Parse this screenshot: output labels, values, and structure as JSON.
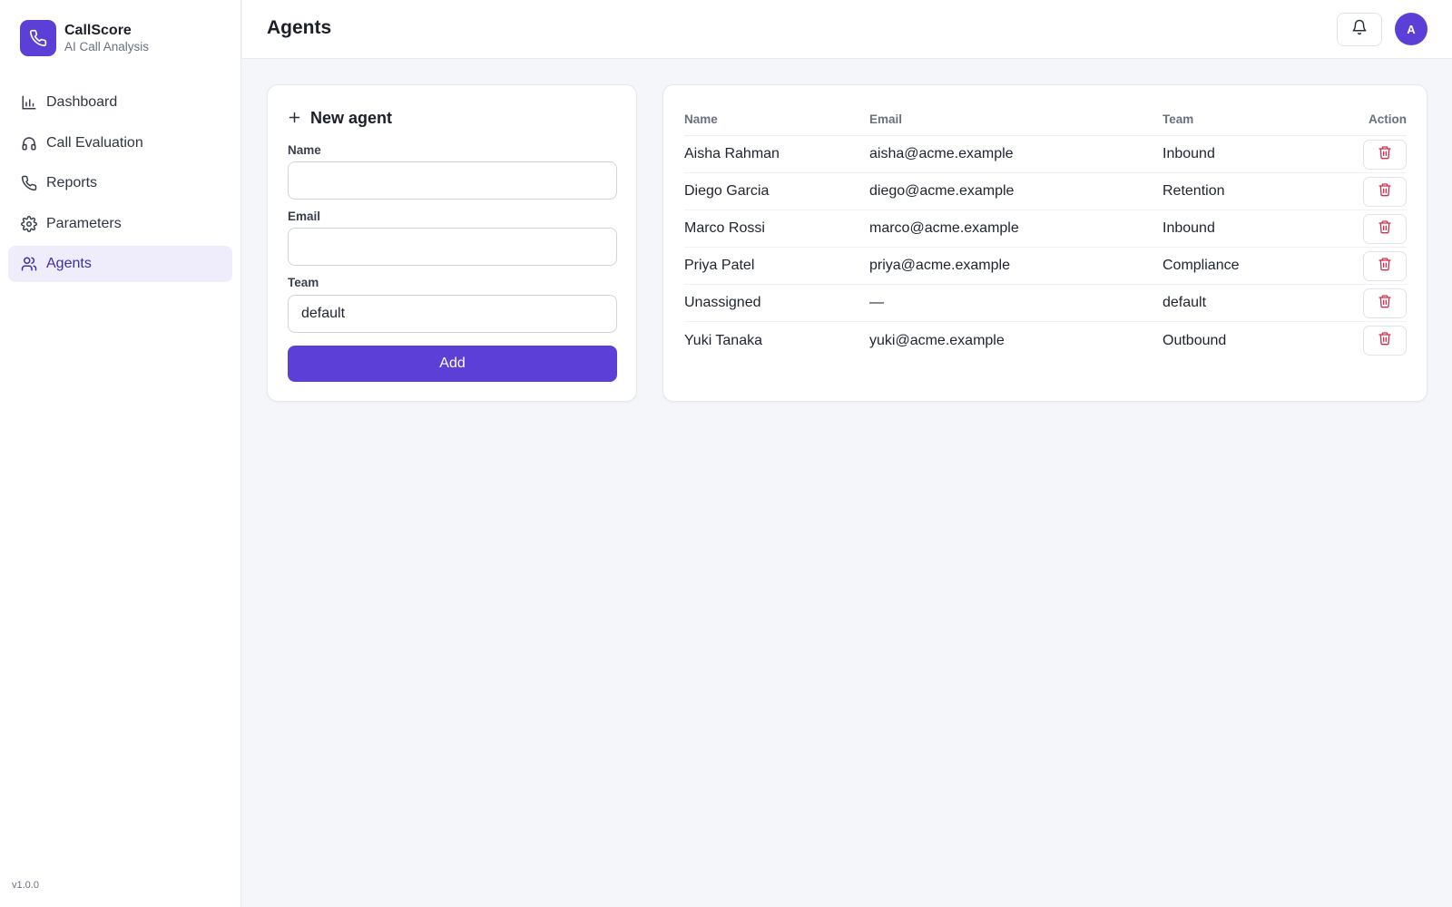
{
  "brand": {
    "title": "CallScore",
    "subtitle": "AI Call Analysis",
    "icon": "phone-icon",
    "color": "#5b3fd6"
  },
  "sidebar": {
    "items": [
      {
        "label": "Dashboard",
        "icon": "bar-chart-icon",
        "active": false
      },
      {
        "label": "Call Evaluation",
        "icon": "headphones-icon",
        "active": false
      },
      {
        "label": "Reports",
        "icon": "phone-icon",
        "active": false
      },
      {
        "label": "Parameters",
        "icon": "gear-icon",
        "active": false
      },
      {
        "label": "Agents",
        "icon": "users-icon",
        "active": true
      }
    ],
    "version": "v1.0.0"
  },
  "header": {
    "title": "Agents",
    "avatar_initial": "A"
  },
  "form": {
    "title": "New agent",
    "name_label": "Name",
    "name_value": "",
    "email_label": "Email",
    "email_value": "",
    "team_label": "Team",
    "team_value": "default",
    "add_label": "Add"
  },
  "table": {
    "columns": [
      "Name",
      "Email",
      "Team",
      "Action"
    ],
    "rows": [
      {
        "name": "Aisha Rahman",
        "email": "aisha@acme.example",
        "team": "Inbound"
      },
      {
        "name": "Diego Garcia",
        "email": "diego@acme.example",
        "team": "Retention"
      },
      {
        "name": "Marco Rossi",
        "email": "marco@acme.example",
        "team": "Inbound"
      },
      {
        "name": "Priya Patel",
        "email": "priya@acme.example",
        "team": "Compliance"
      },
      {
        "name": "Unassigned",
        "email": "—",
        "team": "default"
      },
      {
        "name": "Yuki Tanaka",
        "email": "yuki@acme.example",
        "team": "Outbound"
      }
    ],
    "delete_icon": "trash-icon",
    "delete_color": "#d0304f"
  }
}
